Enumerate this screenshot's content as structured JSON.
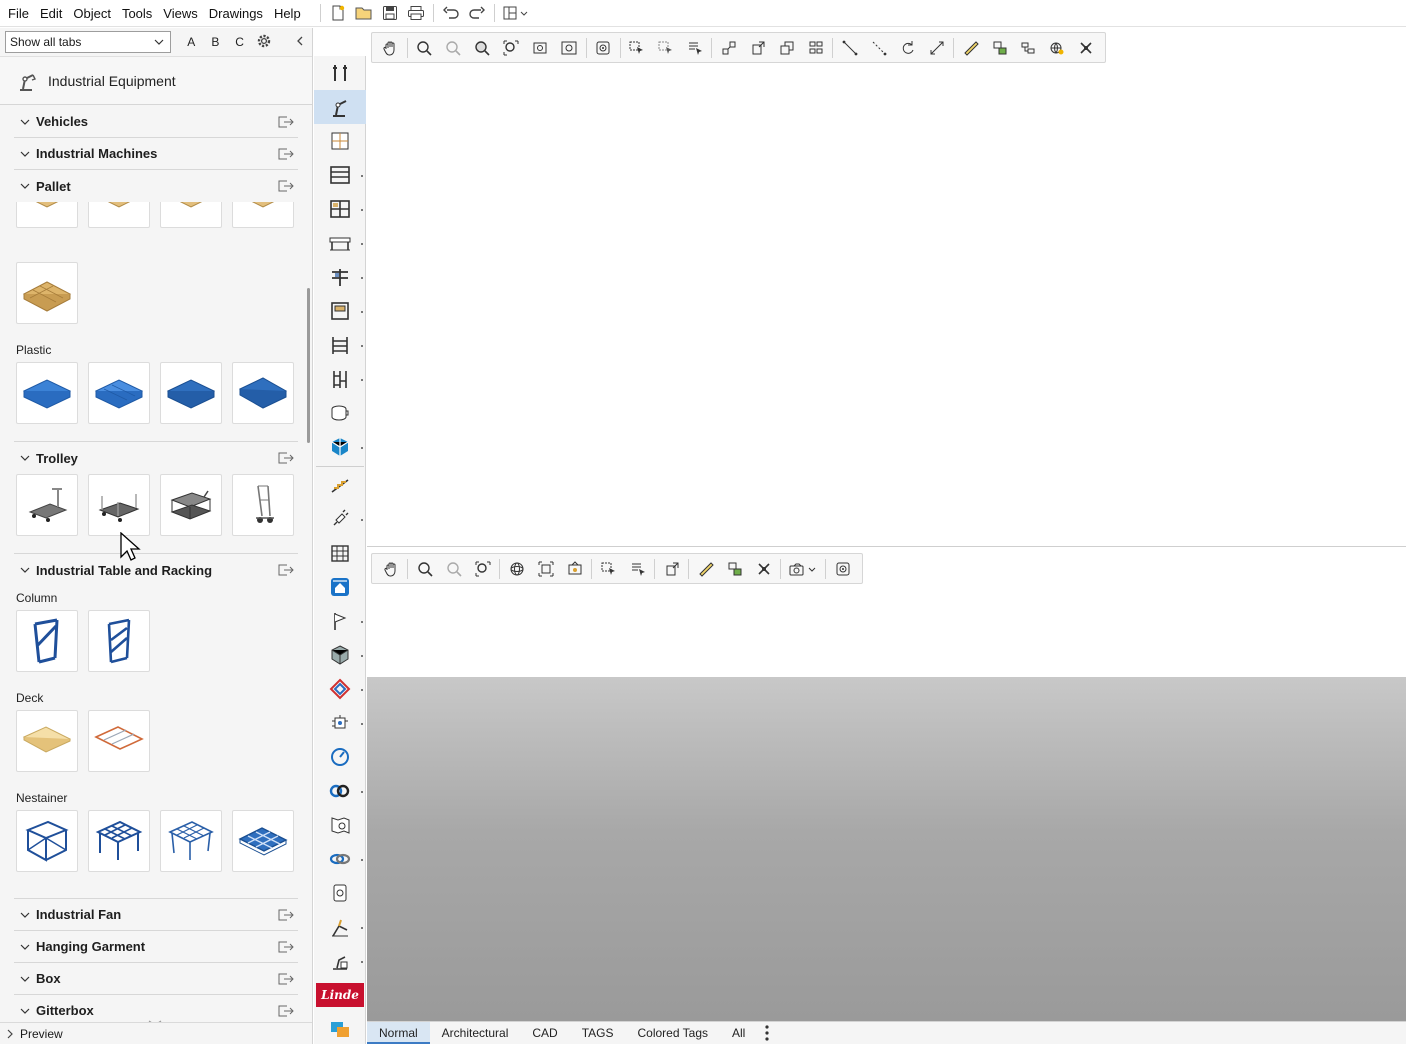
{
  "menu": [
    "File",
    "Edit",
    "Object",
    "Tools",
    "Views",
    "Drawings",
    "Help"
  ],
  "left_panel": {
    "tabs_select": "Show all tabs",
    "letters": [
      "A",
      "B",
      "C"
    ],
    "header_title": "Industrial Equipment",
    "categories": {
      "vehicles": "Vehicles",
      "machines": "Industrial Machines",
      "pallet": "Pallet",
      "trolley": "Trolley",
      "racking": "Industrial Table and Racking",
      "fan": "Industrial Fan",
      "garment": "Hanging Garment",
      "box": "Box",
      "gitterbox": "Gitterbox"
    },
    "subheads": {
      "plastic": "Plastic",
      "column": "Column",
      "deck": "Deck",
      "nestainer": "Nestainer"
    },
    "preview_label": "Preview"
  },
  "view_tabs": [
    "Normal",
    "Architectural",
    "CAD",
    "TAGS",
    "Colored Tags",
    "All"
  ],
  "active_view_tab": "Normal",
  "colors": {
    "accent": "#3c7bc4",
    "tile_blue": "#2f6fbe",
    "wood": "#d9b26a",
    "linde_red": "#c8102e"
  }
}
